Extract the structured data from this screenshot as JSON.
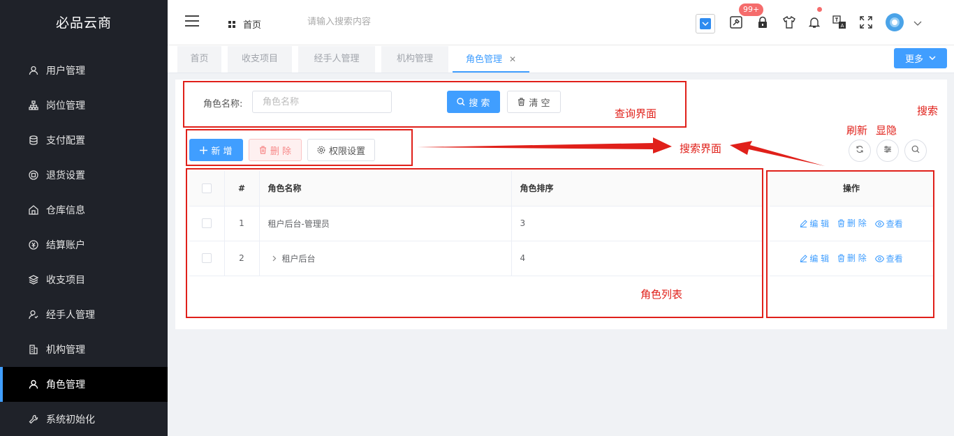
{
  "app": {
    "title": "必品云商"
  },
  "sidebar": {
    "items": [
      {
        "label": "用户管理",
        "icon": "user-icon"
      },
      {
        "label": "岗位管理",
        "icon": "org-icon"
      },
      {
        "label": "支付配置",
        "icon": "database-icon"
      },
      {
        "label": "退货设置",
        "icon": "return-icon"
      },
      {
        "label": "仓库信息",
        "icon": "warehouse-icon"
      },
      {
        "label": "结算账户",
        "icon": "settle-icon"
      },
      {
        "label": "收支项目",
        "icon": "layers-icon"
      },
      {
        "label": "经手人管理",
        "icon": "user-check-icon"
      },
      {
        "label": "机构管理",
        "icon": "building-icon"
      },
      {
        "label": "角色管理",
        "icon": "role-icon",
        "active": true
      },
      {
        "label": "系统初始化",
        "icon": "wrench-icon"
      }
    ]
  },
  "header": {
    "breadcrumb": "首页",
    "search_placeholder": "请输入搜索内容",
    "badge_count": "99+"
  },
  "tabs": {
    "items": [
      "首页",
      "收支项目",
      "经手人管理",
      "机构管理",
      "角色管理"
    ],
    "active": "角色管理",
    "more_label": "更多"
  },
  "query": {
    "label": "角色名称:",
    "placeholder": "角色名称",
    "search_label": "搜 索",
    "clear_label": "清 空"
  },
  "toolbar": {
    "add_label": "新 增",
    "delete_label": "删 除",
    "perm_label": "权限设置"
  },
  "table": {
    "headers": {
      "index": "#",
      "name": "角色名称",
      "sort": "角色排序",
      "ops": "操作"
    },
    "rows": [
      {
        "index": "1",
        "name": "租户后台-管理员",
        "sort": "3"
      },
      {
        "index": "2",
        "name": "租户后台",
        "sort": "4"
      }
    ],
    "ops": {
      "edit": "编 辑",
      "delete": "删 除",
      "view": "查看"
    }
  },
  "annotations": {
    "query_area": "查询界面",
    "search_area": "搜索界面",
    "role_list": "角色列表",
    "refresh": "刷新",
    "toggle": "显隐",
    "search": "搜索"
  },
  "colors": {
    "primary": "#409eff",
    "sidebar_bg": "#1f2229",
    "annotation": "#e0201a"
  }
}
